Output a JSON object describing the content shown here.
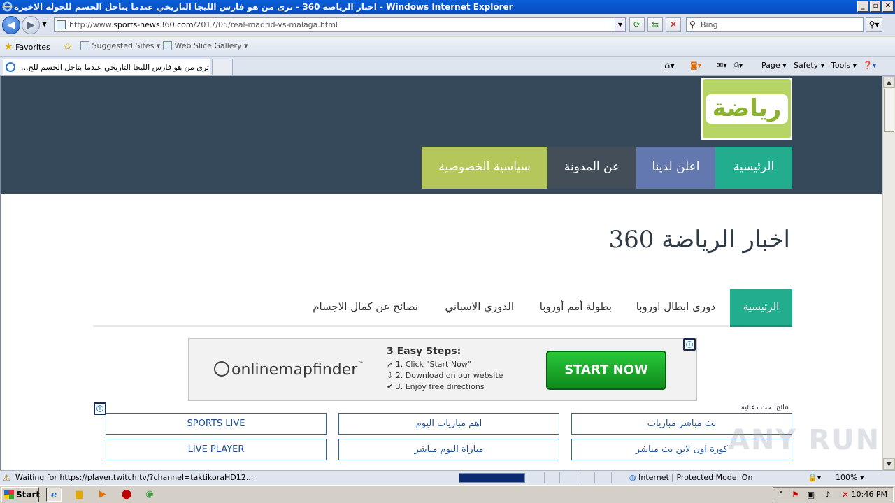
{
  "window": {
    "title": "اخبار الرياضة 360 - ترى من هو فارس الليجا التاريخي عندما يتاجل الحسم للجولة الاخيرة - Windows Internet Explorer",
    "controls": {
      "minimize": "_",
      "maximize": "▫",
      "close": "✕"
    }
  },
  "toolbar": {
    "url_prefix": "http://www.",
    "url_domain": "sports-news360.com",
    "url_path": "/2017/05/real-madrid-vs-malaga.html",
    "search_placeholder": "Bing"
  },
  "favorites_bar": {
    "favorites_label": "Favorites",
    "suggested_sites": "Suggested Sites ▾",
    "web_slice_gallery": "Web Slice Gallery ▾"
  },
  "tab": {
    "title": "ترى من هو فارس الليجا التاريخي عندما يتاجل الحسم للج..."
  },
  "command_bar": {
    "page": "Page ▾",
    "safety": "Safety ▾",
    "tools": "Tools ▾"
  },
  "site": {
    "logo_text": "رياضة",
    "top_nav": [
      {
        "label": "الرئيسية",
        "color": "#23ad8f"
      },
      {
        "label": "اعلن لدينا",
        "color": "#6478b0"
      },
      {
        "label": "عن المدونة",
        "color": "#444e59"
      },
      {
        "label": "سياسية الخصوصية",
        "color": "#b5c75a"
      }
    ],
    "title": "اخبار الرياضة 360",
    "category_nav": {
      "active": "الرئيسية",
      "items": [
        "دورى ابطال اوروبا",
        "بطولة أمم أوروبا",
        "الدوري الاسباني",
        "نصائح عن كمال الاجسام"
      ]
    }
  },
  "ad_banner": {
    "brand": "onlinemapfinder",
    "steps_title": "3 Easy Steps:",
    "steps": [
      "1. Click \"Start Now\"",
      "2. Download on our website",
      "3. Enjoy free directions"
    ],
    "button": "START NOW"
  },
  "ad_links": {
    "label": "نتائج بحث دعائية",
    "links": [
      "SPORTS LIVE",
      "اهم مباريات اليوم",
      "بث مباشر مباريات",
      "LIVE PLAYER",
      "مباراة اليوم مباشر",
      "كورة اون لاين بث مباشر"
    ]
  },
  "status_bar": {
    "text": "Waiting for https://player.twitch.tv/?channel=taktikoraHD12...",
    "progress": 1.0,
    "zone": "Internet | Protected Mode: On",
    "zoom": "100% ▾"
  },
  "taskbar": {
    "start": "Start",
    "clock": "10:46 PM"
  },
  "watermark": "ANY RUN"
}
